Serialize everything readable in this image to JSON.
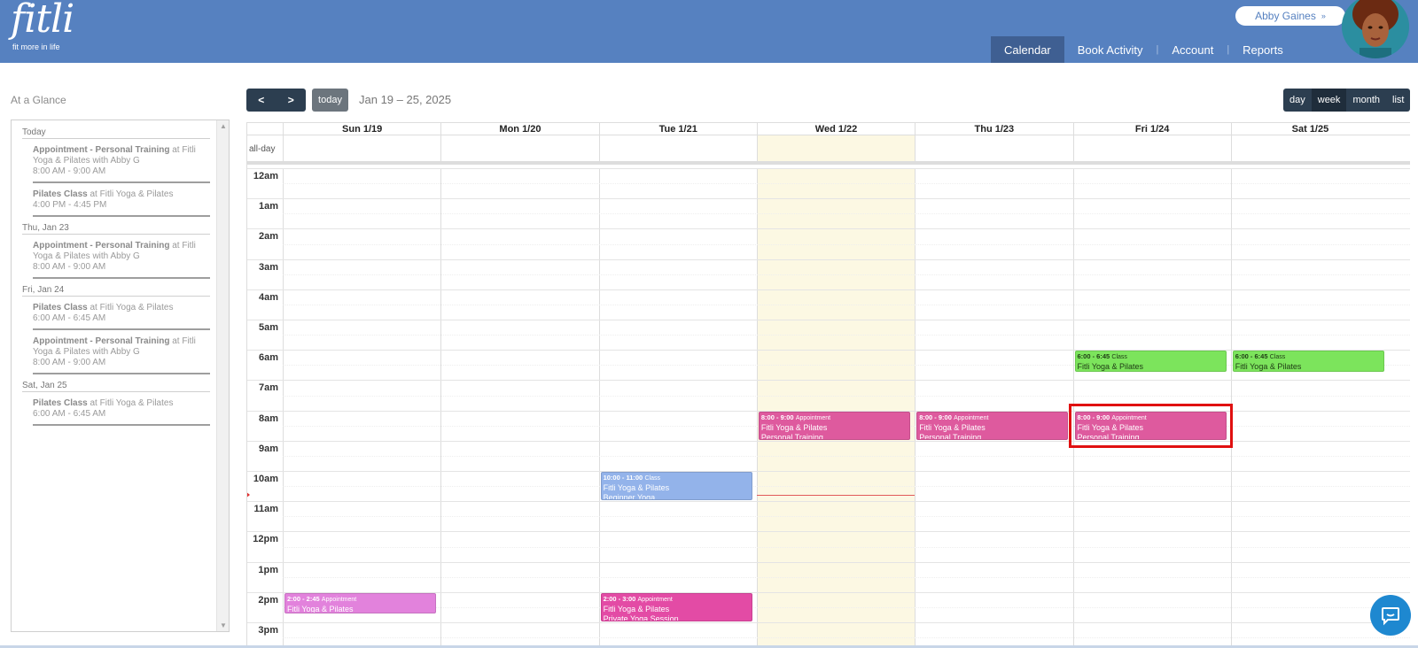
{
  "brand": {
    "logo_text": "fitli",
    "tagline": "fit more in life"
  },
  "user": {
    "name": "Abby Gaines"
  },
  "nav": [
    {
      "label": "Calendar",
      "active": true
    },
    {
      "label": "Book Activity",
      "active": false
    },
    {
      "label": "Account",
      "active": false
    },
    {
      "label": "Reports",
      "active": false
    }
  ],
  "sidebar": {
    "title": "At a Glance",
    "groups": [
      {
        "day": "Today",
        "items": [
          {
            "bold": "Appointment - Personal Training",
            "rest": " at Fitli Yoga & Pilates with Abby G",
            "time": "8:00 AM - 9:00 AM"
          },
          {
            "bold": "Pilates Class",
            "rest": " at Fitli Yoga & Pilates",
            "time": "4:00 PM - 4:45 PM"
          }
        ]
      },
      {
        "day": "Thu, Jan 23",
        "items": [
          {
            "bold": "Appointment - Personal Training",
            "rest": " at Fitli Yoga & Pilates with Abby G",
            "time": "8:00 AM - 9:00 AM"
          }
        ]
      },
      {
        "day": "Fri, Jan 24",
        "items": [
          {
            "bold": "Pilates Class",
            "rest": " at Fitli Yoga & Pilates",
            "time": "6:00 AM - 6:45 AM"
          },
          {
            "bold": "Appointment - Personal Training",
            "rest": " at Fitli Yoga & Pilates with Abby G",
            "time": "8:00 AM - 9:00 AM"
          }
        ]
      },
      {
        "day": "Sat, Jan 25",
        "items": [
          {
            "bold": "Pilates Class",
            "rest": " at Fitli Yoga & Pilates",
            "time": "6:00 AM - 6:45 AM"
          }
        ]
      }
    ]
  },
  "toolbar": {
    "prev": "<",
    "next": ">",
    "today": "today",
    "range": "Jan 19 – 25, 2025",
    "views": [
      {
        "label": "day",
        "active": false
      },
      {
        "label": "week",
        "active": true
      },
      {
        "label": "month",
        "active": false
      },
      {
        "label": "list",
        "active": false
      }
    ]
  },
  "calendar": {
    "allday_label": "all-day",
    "days": [
      "Sun 1/19",
      "Mon 1/20",
      "Tue 1/21",
      "Wed 1/22",
      "Thu 1/23",
      "Fri 1/24",
      "Sat 1/25"
    ],
    "today_index": 3,
    "hours": [
      "12am",
      "1am",
      "2am",
      "3am",
      "4am",
      "5am",
      "6am",
      "7am",
      "8am",
      "9am",
      "10am",
      "11am",
      "12pm",
      "1pm",
      "2pm",
      "3pm"
    ],
    "now_hour": 10.8,
    "events": [
      {
        "day": 5,
        "start": 6,
        "end": 6.75,
        "time": "6:00 - 6:45",
        "type": "Class",
        "lines": [
          "Fitli Yoga & Pilates"
        ],
        "color": "green"
      },
      {
        "day": 6,
        "start": 6,
        "end": 6.75,
        "time": "6:00 - 6:45",
        "type": "Class",
        "lines": [
          "Fitli Yoga & Pilates"
        ],
        "color": "green"
      },
      {
        "day": 3,
        "start": 8,
        "end": 9,
        "time": "8:00 - 9:00",
        "type": "Appointment",
        "lines": [
          "Fitli Yoga & Pilates",
          "Personal Training"
        ],
        "color": "pink"
      },
      {
        "day": 4,
        "start": 8,
        "end": 9,
        "time": "8:00 - 9:00",
        "type": "Appointment",
        "lines": [
          "Fitli Yoga & Pilates",
          "Personal Training"
        ],
        "color": "pink"
      },
      {
        "day": 5,
        "start": 8,
        "end": 9,
        "time": "8:00 - 9:00",
        "type": "Appointment",
        "lines": [
          "Fitli Yoga & Pilates",
          "Personal Training"
        ],
        "color": "pink",
        "highlighted": true
      },
      {
        "day": 2,
        "start": 10,
        "end": 11,
        "time": "10:00 - 11:00",
        "type": "Class",
        "lines": [
          "Fitli Yoga & Pilates",
          "Beginner Yoga"
        ],
        "color": "blue"
      },
      {
        "day": 0,
        "start": 14,
        "end": 14.75,
        "time": "2:00 - 2:45",
        "type": "Appointment",
        "lines": [
          "Fitli Yoga & Pilates"
        ],
        "color": "violet"
      },
      {
        "day": 2,
        "start": 14,
        "end": 15,
        "time": "2:00 - 3:00",
        "type": "Appointment",
        "lines": [
          "Fitli Yoga & Pilates",
          "Private Yoga Session"
        ],
        "color": "magenta"
      }
    ]
  },
  "icons": {
    "chat": "chat-bubble-icon",
    "user_chevron": "double-chevron-down-icon"
  }
}
